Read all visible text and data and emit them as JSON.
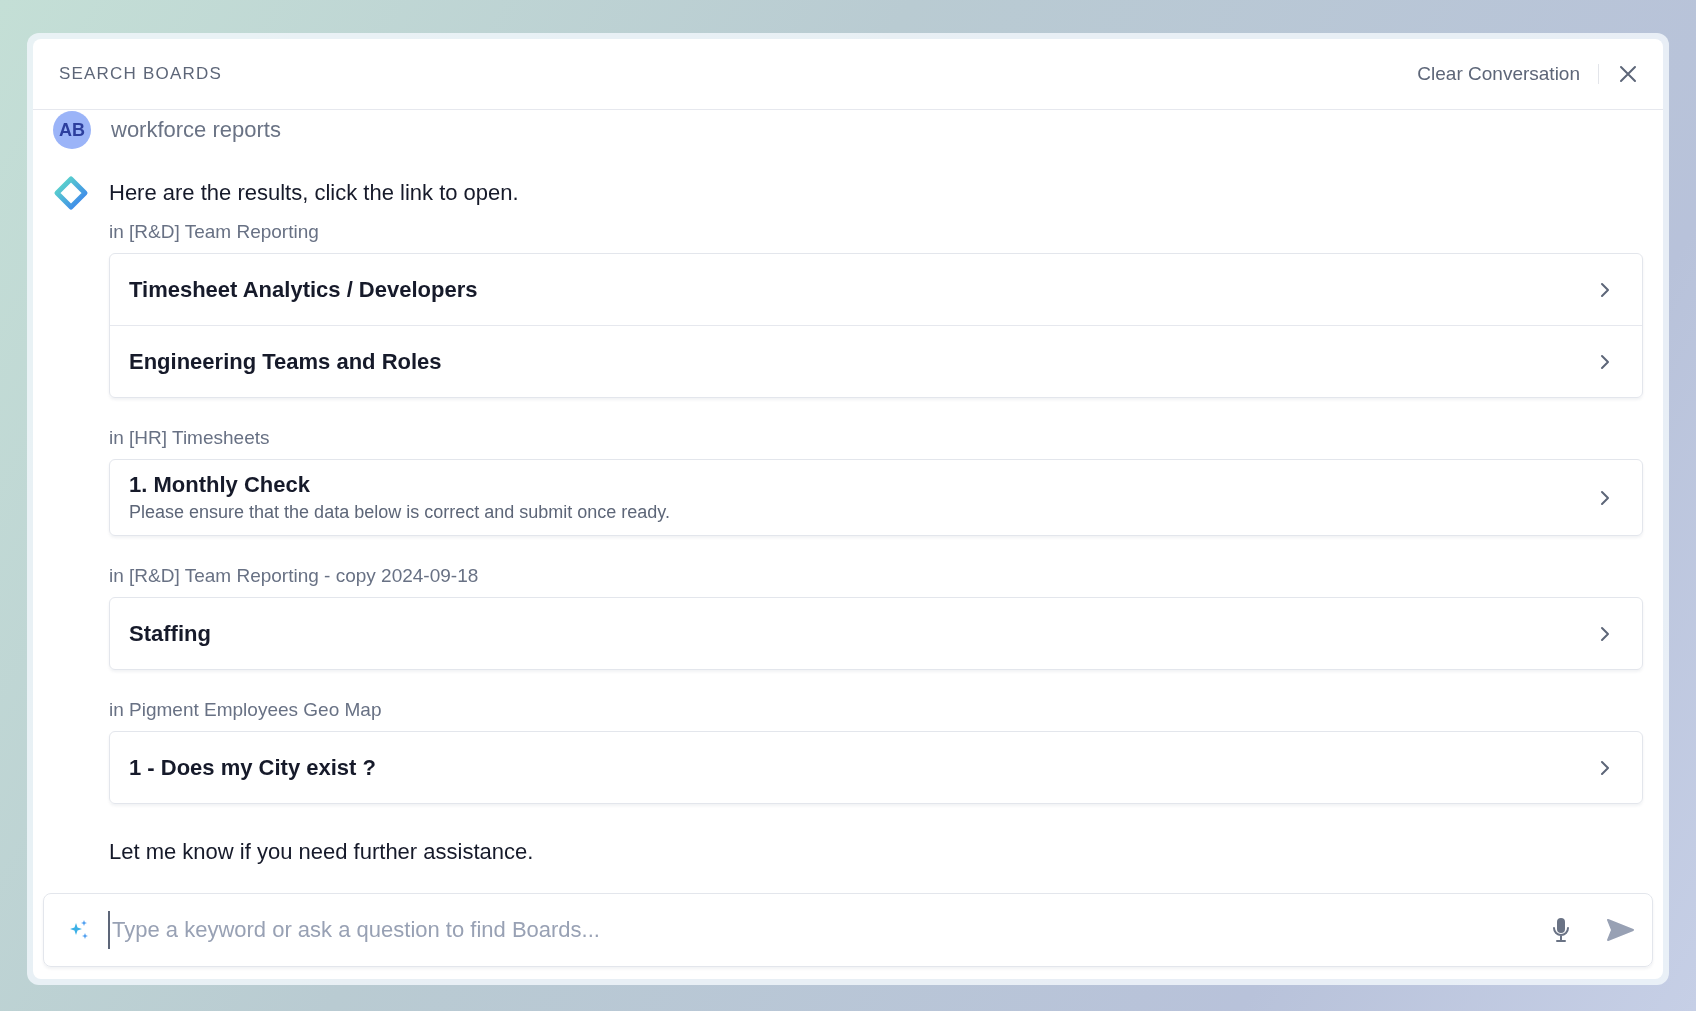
{
  "header": {
    "title": "SEARCH BOARDS",
    "clear_button": "Clear Conversation"
  },
  "messages": [
    {
      "kind": "user",
      "avatar": "AB",
      "text": "workforce reports"
    },
    {
      "kind": "assistant",
      "intro": "Here are the results, click the link to open.",
      "groups": [
        {
          "label": "in [R&D] Team Reporting",
          "results": [
            {
              "title": "Timesheet Analytics / Developers"
            },
            {
              "title": "Engineering Teams and Roles"
            }
          ]
        },
        {
          "label": "in [HR] Timesheets",
          "results": [
            {
              "title": "1. Monthly Check",
              "description": "Please ensure that the data below is correct and submit once ready."
            }
          ]
        },
        {
          "label": "in [R&D] Team Reporting - copy 2024-09-18",
          "results": [
            {
              "title": "Staffing"
            }
          ]
        },
        {
          "label": "in Pigment Employees Geo Map",
          "results": [
            {
              "title": "1 - Does my City exist ?"
            }
          ]
        }
      ],
      "outro": "Let me know if you need further assistance."
    }
  ],
  "input": {
    "placeholder": "Type a keyword or ask a question to find Boards..."
  }
}
